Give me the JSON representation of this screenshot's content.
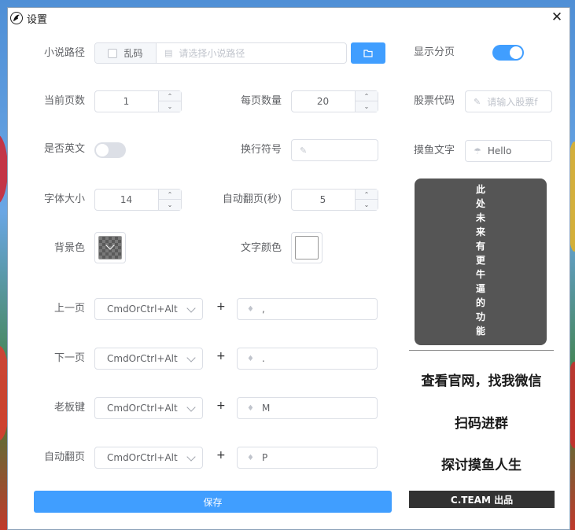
{
  "window": {
    "title": "设置",
    "close_glyph": "✕"
  },
  "form": {
    "novel_path": {
      "label": "小说路径",
      "garbled_label": "乱码",
      "placeholder": "请选择小说路径"
    },
    "show_paging": {
      "label": "显示分页",
      "on": true
    },
    "current_page": {
      "label": "当前页数",
      "value": "1"
    },
    "per_page": {
      "label": "每页数量",
      "value": "20"
    },
    "stock_code": {
      "label": "股票代码",
      "placeholder": "请输入股票f"
    },
    "is_english": {
      "label": "是否英文",
      "on": false
    },
    "line_break": {
      "label": "换行符号",
      "value": ""
    },
    "slack_text": {
      "label": "摸鱼文字",
      "value": "Hello"
    },
    "font_size": {
      "label": "字体大小",
      "value": "14"
    },
    "auto_flip_seconds": {
      "label": "自动翻页(秒)",
      "value": "5"
    },
    "bg_color": {
      "label": "背景色"
    },
    "text_color": {
      "label": "文字颜色"
    },
    "shortcuts": [
      {
        "label": "上一页",
        "modifier": "CmdOrCtrl+Alt",
        "plus": "+",
        "key": ","
      },
      {
        "label": "下一页",
        "modifier": "CmdOrCtrl+Alt",
        "plus": "+",
        "key": "."
      },
      {
        "label": "老板键",
        "modifier": "CmdOrCtrl+Alt",
        "plus": "+",
        "key": "M"
      },
      {
        "label": "自动翻页",
        "modifier": "CmdOrCtrl+Alt",
        "plus": "+",
        "key": "P"
      }
    ],
    "save_label": "保存"
  },
  "side": {
    "future_chars": [
      "此",
      "处",
      "未",
      "来",
      "有",
      "更",
      "牛",
      "逼",
      "的",
      "功",
      "能"
    ],
    "promo_line1": "查看官网，找我微信",
    "promo_line2": "扫码进群",
    "promo_line3": "探讨摸鱼人生",
    "credit": "C.TEAM 出品"
  },
  "colors": {
    "accent": "#409eff",
    "future_bg": "#555555",
    "credit_bg": "#333333"
  }
}
